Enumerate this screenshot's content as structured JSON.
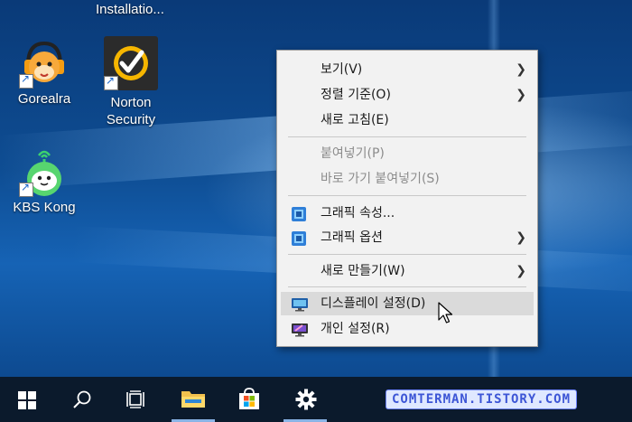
{
  "desktop": {
    "top_label": "Installatio...",
    "icons": [
      {
        "label": "Gorealra"
      },
      {
        "label": "Norton\nSecurity"
      },
      {
        "label": "KBS Kong"
      }
    ]
  },
  "context_menu": {
    "items": [
      {
        "label": "보기(V)",
        "submenu": true,
        "disabled": false
      },
      {
        "label": "정렬 기준(O)",
        "submenu": true,
        "disabled": false
      },
      {
        "label": "새로 고침(E)",
        "submenu": false,
        "disabled": false
      },
      {
        "label": "붙여넣기(P)",
        "submenu": false,
        "disabled": true
      },
      {
        "label": "바로 가기 붙여넣기(S)",
        "submenu": false,
        "disabled": true
      },
      {
        "label": "그래픽 속성...",
        "submenu": false,
        "disabled": false,
        "icon": "intel-graphics-icon"
      },
      {
        "label": "그래픽 옵션",
        "submenu": true,
        "disabled": false,
        "icon": "intel-graphics-icon"
      },
      {
        "label": "새로 만들기(W)",
        "submenu": true,
        "disabled": false
      },
      {
        "label": "디스플레이 설정(D)",
        "submenu": false,
        "disabled": false,
        "highlighted": true,
        "icon": "display-icon"
      },
      {
        "label": "개인 설정(R)",
        "submenu": false,
        "disabled": false,
        "icon": "personalize-icon"
      }
    ]
  },
  "taskbar": {
    "buttons": [
      "start-icon",
      "search-icon",
      "task-view-icon",
      "file-explorer-icon",
      "store-icon",
      "settings-icon"
    ],
    "watermark": "COMTERMAN.TISTORY.COM"
  },
  "colors": {
    "taskbar": "#0b1a2c",
    "menu_bg": "#f2f2f2",
    "highlight": "#dadada",
    "accent": "#8ab4e6"
  }
}
